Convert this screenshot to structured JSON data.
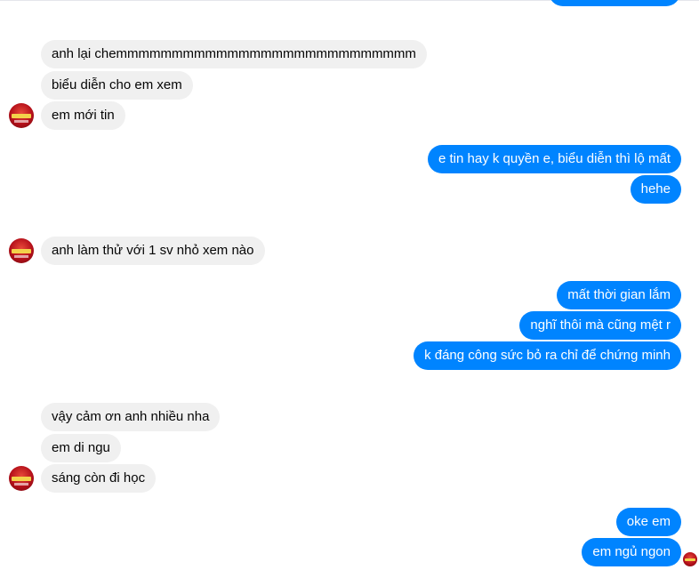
{
  "messages": {
    "in_1": "anh lại chemmmmmmmmmmmmmmmmmmmmmmmmmmm",
    "in_2": "biểu diễn cho em xem",
    "in_3": "em mới tin",
    "out_1": "e tin hay k quyền e, biểu diễn thì lộ mất",
    "out_2": "hehe",
    "in_4": "anh làm thử với 1 sv nhỏ xem nào",
    "out_3": "mất thời gian lắm",
    "out_4": "nghĩ thôi mà cũng mệt r",
    "out_5": "k đáng công sức bỏ ra chỉ để chứng minh",
    "in_5": "vậy cảm ơn anh nhiều nha",
    "in_6": "em di ngu",
    "in_7": "sáng còn đi học",
    "out_6": "oke em",
    "out_7": "em ngủ ngon"
  },
  "colors": {
    "incoming_bubble": "#f0f0f0",
    "outgoing_bubble": "#0084ff",
    "incoming_text": "#050505",
    "outgoing_text": "#ffffff"
  },
  "icons": {
    "contact_avatar": "red-round-badge-avatar",
    "seen_indicator": "small-avatar-read-receipt"
  }
}
